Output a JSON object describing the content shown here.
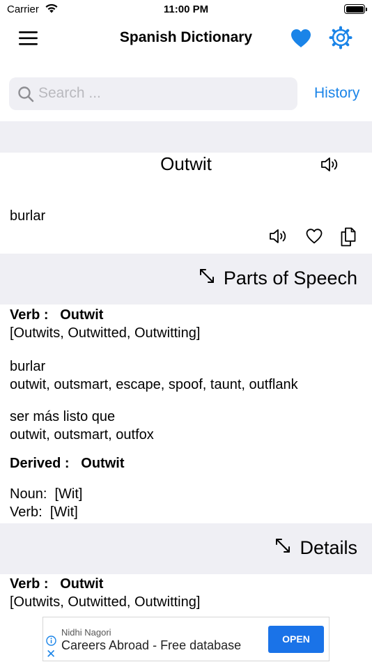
{
  "status_bar": {
    "carrier": "Carrier",
    "time": "11:00 PM"
  },
  "nav": {
    "title": "Spanish Dictionary",
    "menu_icon": "hamburger-menu-icon",
    "favorites_icon": "heart-filled-icon",
    "settings_icon": "gear-icon"
  },
  "search": {
    "placeholder": "Search ...",
    "value": "",
    "history_label": "History"
  },
  "entry": {
    "word": "Outwit",
    "translation": "burlar"
  },
  "sections": {
    "parts_of_speech_label": "Parts of Speech",
    "details_label": "Details"
  },
  "parts_of_speech": {
    "verb_label": "Verb :",
    "verb_word": "Outwit",
    "verb_forms": "[Outwits, Outwitted, Outwitting]",
    "meanings": [
      {
        "term": "burlar",
        "synonyms": "outwit, outsmart, escape, spoof, taunt, outflank"
      },
      {
        "term": "ser más listo que",
        "synonyms": "outwit, outsmart, outfox"
      }
    ],
    "derived_label": "Derived :",
    "derived_word": "Outwit",
    "derived_items": [
      {
        "label": "Noun:",
        "value": "[Wit]"
      },
      {
        "label": "Verb:",
        "value": "[Wit]"
      }
    ]
  },
  "details": {
    "verb_label": "Verb :",
    "verb_word": "Outwit",
    "verb_forms": "[Outwits, Outwitted, Outwitting]"
  },
  "ad": {
    "advertiser": "Nidhi Nagori",
    "title": "Careers Abroad - Free database",
    "cta": "OPEN"
  },
  "colors": {
    "accent": "#1a84e8",
    "band_gray": "#efeff4",
    "heart_blue": "#1a84e8"
  }
}
